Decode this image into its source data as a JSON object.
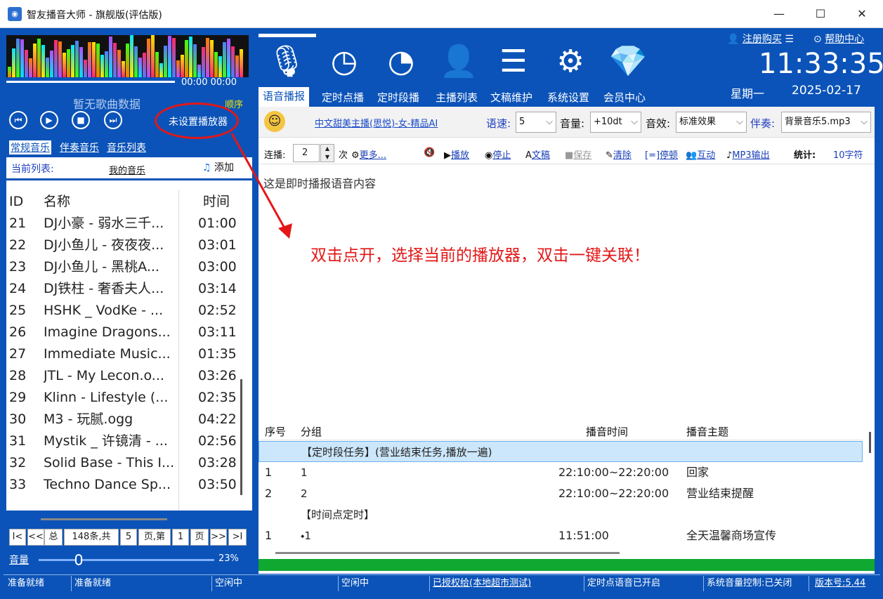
{
  "window": {
    "title": "智友播音大师 - 旗舰版(评估版)",
    "minimize": "—",
    "maximize": "☐",
    "close": "✕"
  },
  "player": {
    "time_elapsed": "00:00",
    "time_total": "00:00",
    "no_song": "暂无歌曲数据",
    "order_mode": "顺序",
    "no_player": "未设置播放器",
    "controls": [
      "prev-icon",
      "play-icon",
      "stop-icon",
      "next-icon"
    ]
  },
  "left_tabs": [
    "常规音乐",
    "伴奏音乐",
    "音乐列表"
  ],
  "current_list": {
    "label": "当前列表:",
    "name": "我的音乐",
    "add": "添加"
  },
  "song_table": {
    "headers": [
      "ID",
      "名称",
      "时间"
    ],
    "rows": [
      {
        "id": "21",
        "name": "DJ小豪 - 弱水三千...",
        "time": "01:00"
      },
      {
        "id": "22",
        "name": "DJ小鱼儿 - 夜夜夜...",
        "time": "03:01"
      },
      {
        "id": "23",
        "name": "DJ小鱼儿 - 黑桃A...",
        "time": "03:00"
      },
      {
        "id": "24",
        "name": "DJ铁柱 - 奢香夫人...",
        "time": "03:14"
      },
      {
        "id": "25",
        "name": "HSHK _ VodKe - ...",
        "time": "02:52"
      },
      {
        "id": "26",
        "name": "Imagine Dragons...",
        "time": "03:11"
      },
      {
        "id": "27",
        "name": "Immediate Music...",
        "time": "01:35"
      },
      {
        "id": "28",
        "name": "JTL - My Lecon.o...",
        "time": "03:26"
      },
      {
        "id": "29",
        "name": "Klinn - Lifestyle (...",
        "time": "02:35"
      },
      {
        "id": "30",
        "name": "M3 - 玩腻.ogg",
        "time": "04:22"
      },
      {
        "id": "31",
        "name": "Mystik _ 许镜清 - ...",
        "time": "02:56"
      },
      {
        "id": "32",
        "name": "Solid Base - This I...",
        "time": "03:28"
      },
      {
        "id": "33",
        "name": "Techno Dance Sp...",
        "time": "03:50"
      }
    ]
  },
  "pager": {
    "first": "I<",
    "prev": "<<",
    "total_label": "总",
    "total": "148条,共",
    "pages": "5",
    "page_label": "页,第",
    "current": "1",
    "page_suffix": "页",
    "next": ">>",
    "last": ">I"
  },
  "volume": {
    "label": "音量",
    "value": "23%",
    "level": 0.23
  },
  "header": {
    "register": "注册购买",
    "help": "帮助中心",
    "clock": "11:33:35",
    "weekday": "星期一",
    "date": "2025-02-17"
  },
  "nav_tabs": [
    "语音播报",
    "定时点播",
    "定时段播",
    "主播列表",
    "文稿维护",
    "系统设置",
    "会员中心"
  ],
  "voice_settings": {
    "anchor": "中文甜美主播(思悦)-女-精品AI",
    "speed_label": "语速:",
    "speed": "5",
    "volume_label": "音量:",
    "volume": "+10dt",
    "effect_label": "音效:",
    "effect": "标准效果",
    "bgm_label": "伴奏:",
    "bgm": "背景音乐5.mp3"
  },
  "toolbar": {
    "repeat_label": "连播:",
    "repeat": "2",
    "times": "次",
    "more": "更多...",
    "play": "播放",
    "stop": "停止",
    "doc": "文稿",
    "save": "保存",
    "clear": "清除",
    "pause": "停顿",
    "interact": "互动",
    "mp3": "MP3输出",
    "stats_label": "统计:",
    "stats": "10字符"
  },
  "content_text": "这是即时播报语音内容",
  "annotation": "双击点开，选择当前的播放器，双击一键关联！",
  "schedule": {
    "headers": [
      "序号",
      "分组",
      "播音时间",
      "播音主题"
    ],
    "rows": [
      {
        "no": "",
        "group": "【定时段任务】(营业结束任务,播放一遍)",
        "time": "",
        "topic": "",
        "highlight": true
      },
      {
        "no": "1",
        "group": "1",
        "time": "22:10:00~22:20:00",
        "topic": "回家"
      },
      {
        "no": "2",
        "group": "2",
        "time": "22:10:00~22:20:00",
        "topic": "营业结束提醒"
      },
      {
        "no": "",
        "group": "【时间点定时】",
        "time": "",
        "topic": ""
      },
      {
        "no": "1",
        "group": "⬩1",
        "time": "11:51:00",
        "topic": "全天温馨商场宣传"
      }
    ]
  },
  "status_bar": [
    "准备就绪",
    "准备就绪",
    "空闲中",
    "空闲中",
    "已授权给(本地超市测试)",
    "定时点语音已开启",
    "系统音量控制:已关闭",
    "版本号:5.44"
  ],
  "colors": {
    "primary": "#0b53b8",
    "annotation": "#e31717",
    "progress": "#11a832",
    "highlight": "#cce6fb"
  }
}
